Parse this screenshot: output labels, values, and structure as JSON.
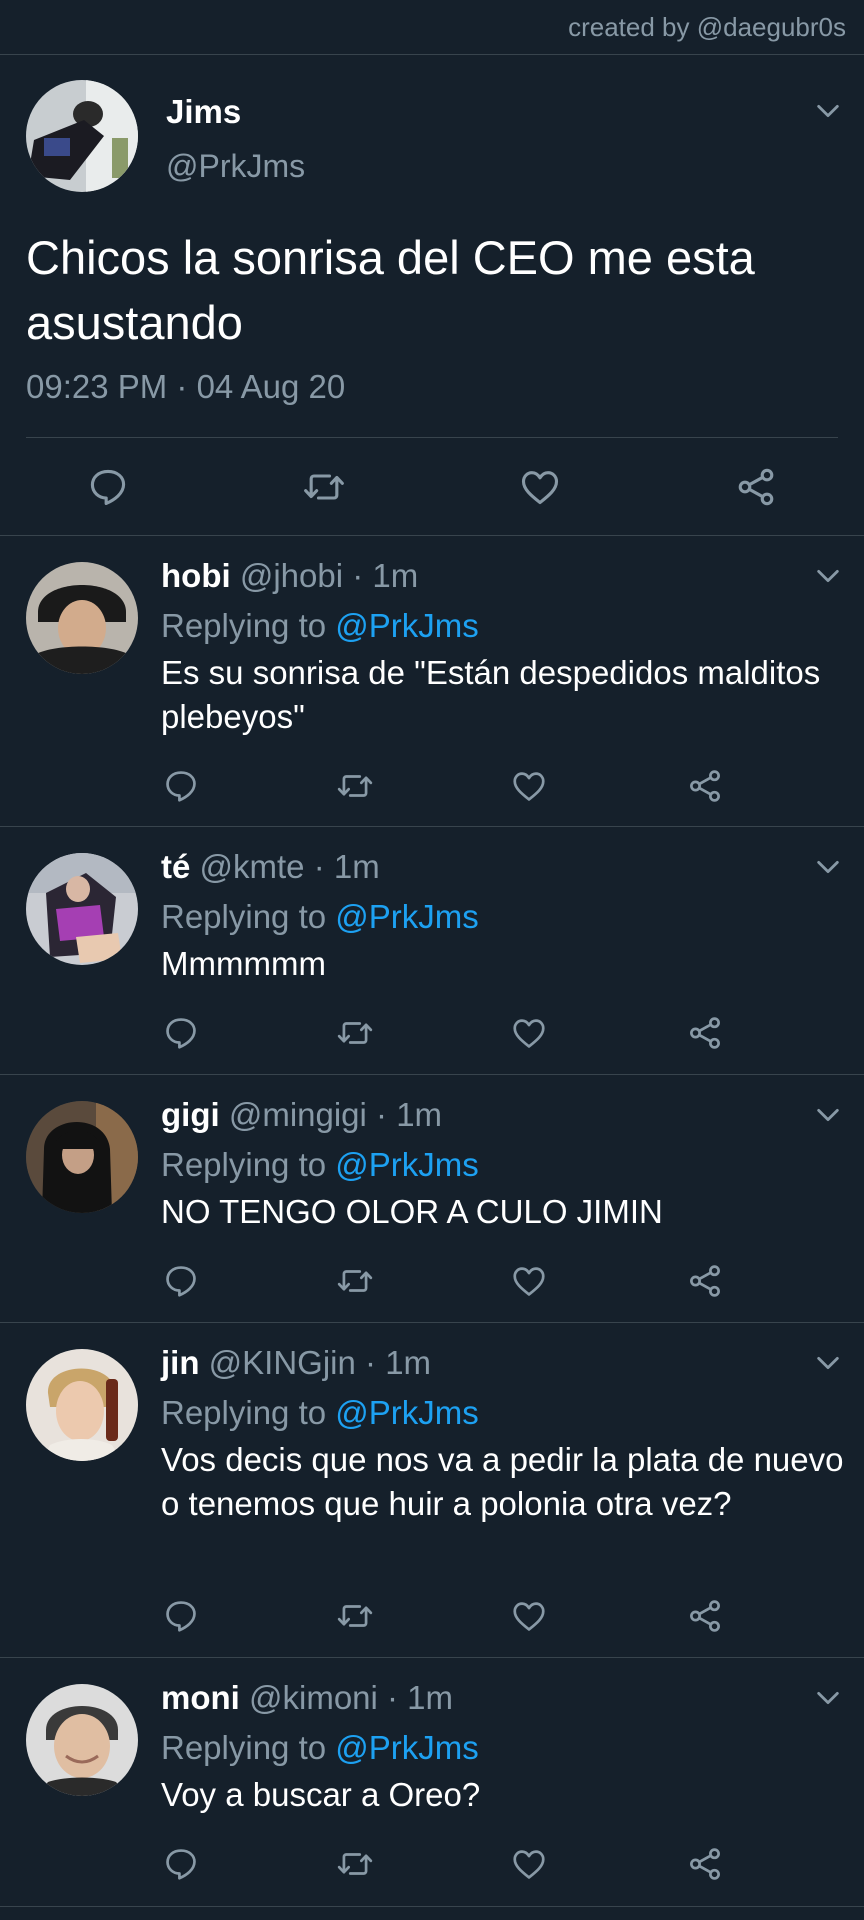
{
  "credit": "created by @daegubr0s",
  "main_tweet": {
    "name": "Jims",
    "handle": "@PrkJms",
    "text": "Chicos la sonrisa del CEO me esta asustando",
    "timestamp": "09:23 PM · 04 Aug 20",
    "actions": [
      "reply-icon",
      "retweet-icon",
      "like-icon",
      "share-icon"
    ]
  },
  "replies": [
    {
      "name": "hobi",
      "meta": "@jhobi · 1m",
      "replying_prefix": "Replying to ",
      "replying_to": "@PrkJms",
      "text": "Es su sonrisa de \"Están despedidos malditos plebeyos\""
    },
    {
      "name": "té",
      "meta": "@kmte · 1m",
      "replying_prefix": "Replying to ",
      "replying_to": "@PrkJms",
      "text": "Mmmmmm"
    },
    {
      "name": "gigi",
      "meta": "@mingigi · 1m",
      "replying_prefix": "Replying to ",
      "replying_to": "@PrkJms",
      "text": "NO TENGO OLOR A CULO JIMIN"
    },
    {
      "name": "jin",
      "meta": "@KINGjin · 1m",
      "replying_prefix": "Replying to ",
      "replying_to": "@PrkJms",
      "text": "Vos decis que nos va a pedir la plata de nuevo o tenemos que huir a polonia otra vez?"
    },
    {
      "name": "moni",
      "meta": "@kimoni · 1m",
      "replying_prefix": "Replying to ",
      "replying_to": "@PrkJms",
      "text": "Voy a buscar a Oreo?"
    }
  ],
  "colors": {
    "background": "#15202b",
    "secondary_text": "#8899a6",
    "mention": "#1da1f2",
    "divider": "#38444d"
  }
}
